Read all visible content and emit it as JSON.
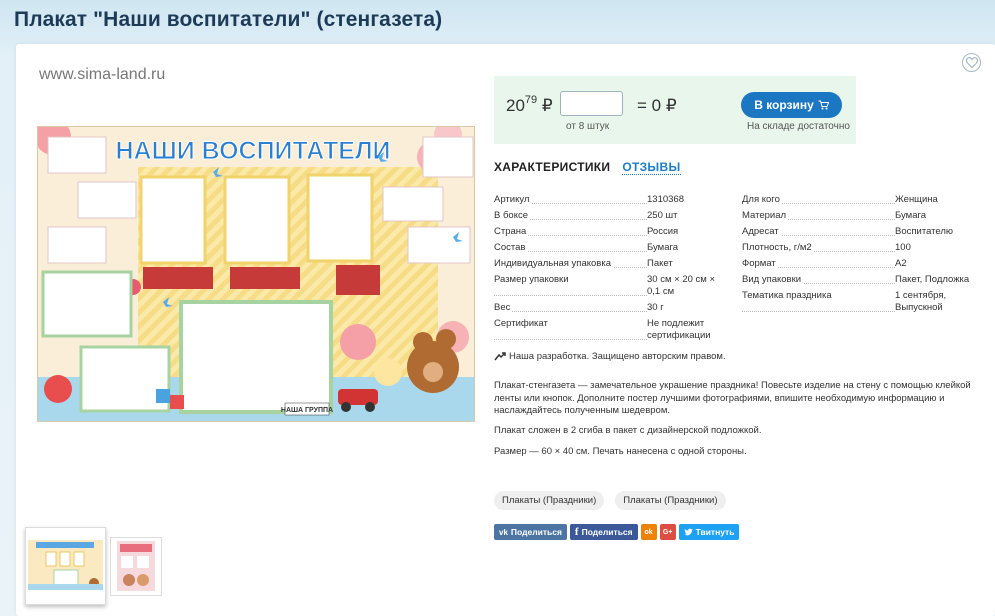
{
  "page": {
    "title": "Плакат \"Наши воспитатели\" (стенгазета)"
  },
  "gallery": {
    "watermark": "www.sima-land.ru",
    "poster_title": "НАШИ ВОСПИТАТЕЛИ",
    "poster_footer": "НАША ГРУППА",
    "thumbnails": 2
  },
  "buy": {
    "price_int": "20",
    "price_frac": "79",
    "currency": "₽",
    "qty_value": "",
    "qty_placeholder": "",
    "min_qty": "от 8 штук",
    "total": "= 0 ₽",
    "cart_label": "В корзину",
    "stock": "На складе достаточно"
  },
  "tabs": {
    "characteristics": "ХАРАКТЕРИСТИКИ",
    "reviews": "ОТЗЫВЫ"
  },
  "specs_left": [
    {
      "label": "Артикул",
      "value": "1310368"
    },
    {
      "label": "В боксе",
      "value": "250 шт"
    },
    {
      "label": "Страна",
      "value": "Россия"
    },
    {
      "label": "Состав",
      "value": "Бумага"
    },
    {
      "label": "Индивидуальная упаковка",
      "value": "Пакет"
    },
    {
      "label": "Размер упаковки",
      "value": "30 см × 20 см × 0,1 см"
    },
    {
      "label": "Вес",
      "value": "30 г"
    },
    {
      "label": "Сертификат",
      "value": "Не подлежит сертификации"
    }
  ],
  "specs_right": [
    {
      "label": "Для кого",
      "value": "Женщина"
    },
    {
      "label": "Материал",
      "value": "Бумага"
    },
    {
      "label": "Адресат",
      "value": "Воспитателю"
    },
    {
      "label": "Плотность, г/м2",
      "value": "100"
    },
    {
      "label": "Формат",
      "value": "А2"
    },
    {
      "label": "Вид упаковки",
      "value": "Пакет, Подложка"
    },
    {
      "label": "Тематика праздника",
      "value": "1 сентября, Выпускной"
    }
  ],
  "own_development": "Наша разработка. Защищено авторским правом.",
  "description": [
    "Плакат-стенгазета — замечательное украшение праздника! Повесьте изделие на стену с помощью клейкой ленты или кнопок. Дополните постер лучшими фотографиями, впишите необходимую информацию и наслаждайтесь полученным шедевром.",
    "Плакат сложен в 2 сгиба в пакет с дизайнерской подложкой.",
    "Размер — 60 × 40 см. Печать нанесена с одной стороны."
  ],
  "tags": [
    "Плакаты (Праздники)",
    "Плакаты (Праздники)"
  ],
  "share": {
    "vk": "Поделиться",
    "fb": "Поделиться",
    "tw": "Твитнуть",
    "ok_glyph": "ok",
    "gp_glyph": "G+"
  },
  "colors": {
    "accent": "#1c77c3",
    "title": "#1d3b57",
    "price_bg": "#e9f6ec",
    "link": "#1d7fc5"
  }
}
